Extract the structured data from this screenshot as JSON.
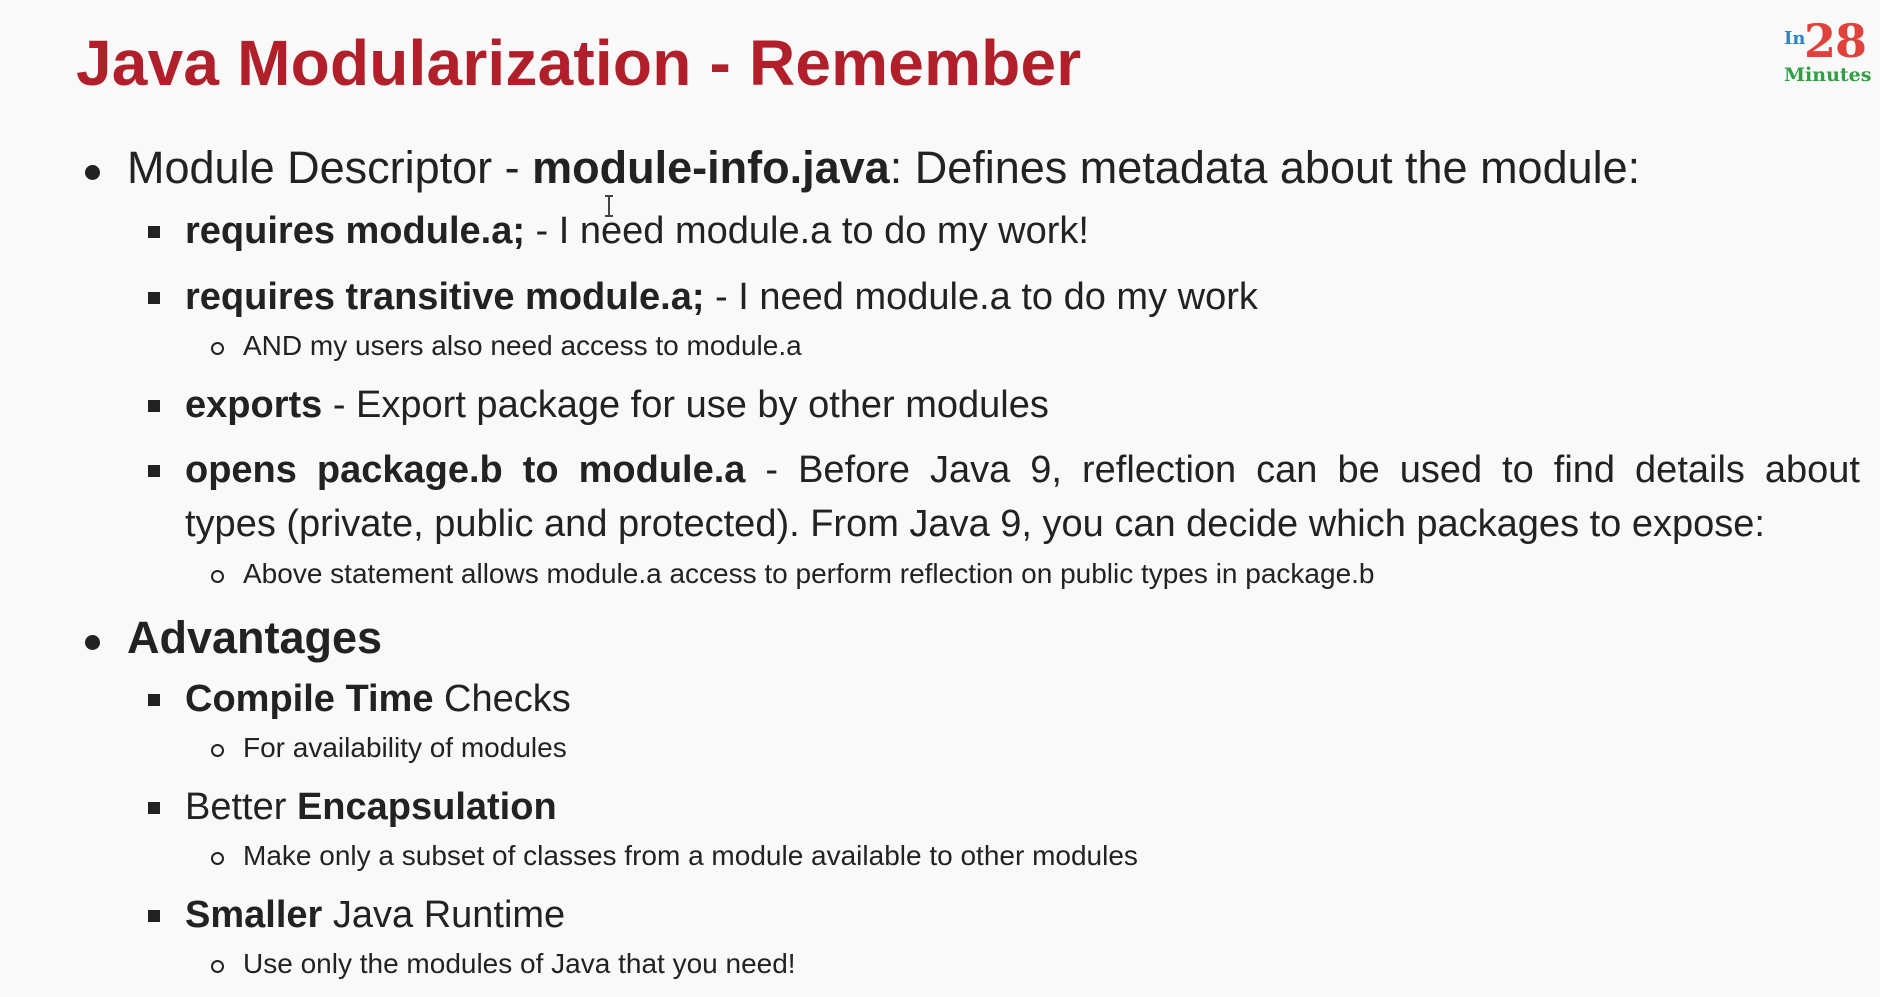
{
  "title": "Java Modularization - Remember",
  "logo": {
    "in": "In",
    "num": "28",
    "minutes": "Minutes"
  },
  "sections": [
    {
      "bullet_prefix": "Module Descriptor - ",
      "bullet_bold": "module-info.java",
      "bullet_suffix": ": Defines metadata about the module:",
      "items": [
        {
          "bold": "requires module.a;",
          "text": " - I need module.a to do my work!"
        },
        {
          "bold": "requires transitive module.a;",
          "text": " - I need module.a to do my work",
          "sub": "AND my users also need access to module.a"
        },
        {
          "bold": "exports",
          "text": " - Export package for use by other modules"
        },
        {
          "bold": "opens package.b to module.a",
          "text_line1": " - Before Java 9, reflection can be used to find details about",
          "text_line2": "types (private, public and protected). From Java 9, you can decide which packages to expose:",
          "sub": "Above statement allows module.a access to perform reflection on public types in package.b"
        }
      ]
    },
    {
      "heading": "Advantages",
      "items": [
        {
          "bold": "Compile Time",
          "text": " Checks",
          "sub": "For availability of modules"
        },
        {
          "prefix": "Better ",
          "bold": "Encapsulation",
          "sub": "Make only a subset of classes from a module available to other modules"
        },
        {
          "bold": "Smaller",
          "text": " Java Runtime",
          "sub": "Use only the modules of Java that you need!"
        }
      ]
    }
  ]
}
